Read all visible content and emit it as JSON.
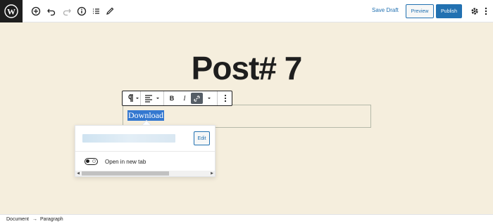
{
  "toolbar": {
    "icons": [
      "wordpress-logo",
      "add-block-icon",
      "undo-icon",
      "redo-icon",
      "info-icon",
      "list-view-icon",
      "edit-tools-icon",
      "settings-gear-icon",
      "more-options-icon"
    ],
    "save_draft_label": "Save Draft",
    "preview_label": "Preview",
    "publish_label": "Publish",
    "accent_color": "#2271b1"
  },
  "post": {
    "title": "Post# 7",
    "paragraph_text": "Download"
  },
  "block_toolbar": {
    "icons": [
      "paragraph-icon",
      "align-icon",
      "bold-icon",
      "italic-icon",
      "link-icon",
      "more-rich-text-icon",
      "block-options-icon"
    ],
    "bold_label": "B",
    "italic_label": "I"
  },
  "link_popover": {
    "edit_label": "Edit",
    "open_new_tab_label": "Open in new tab",
    "open_new_tab_checked": false
  },
  "footer": {
    "breadcrumbs": [
      "Document",
      "Paragraph"
    ],
    "separator": "→"
  },
  "colors": {
    "canvas_bg": "#f5eedd",
    "selection_bg": "#3478d0"
  }
}
